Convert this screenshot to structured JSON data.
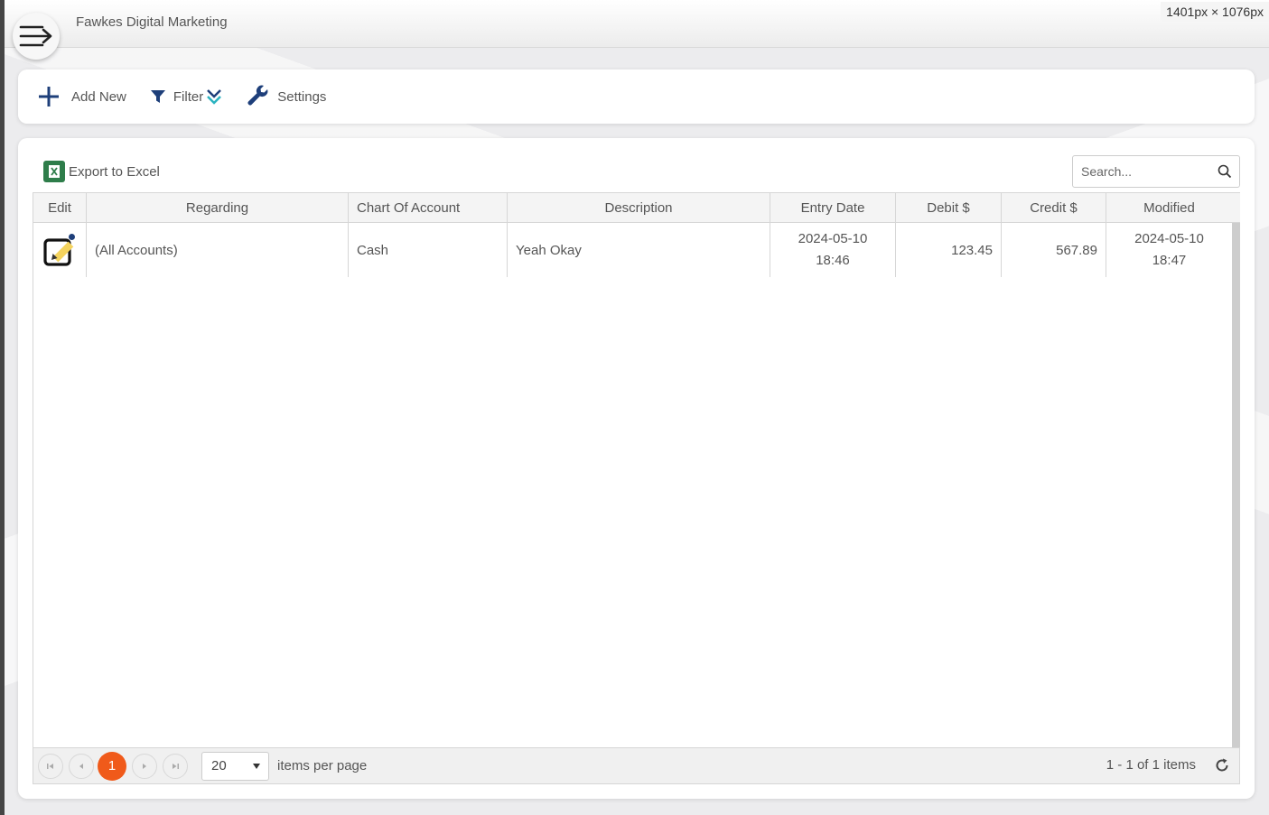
{
  "app": {
    "title": "Fawkes Digital Marketing",
    "dims_badge": "1401px × 1076px"
  },
  "toolbar": {
    "add_new": "Add New",
    "filter": "Filter",
    "settings": "Settings"
  },
  "grid": {
    "export_label": "Export to Excel",
    "search_placeholder": "Search...",
    "columns": [
      "Edit",
      "Regarding",
      "Chart Of Account",
      "Description",
      "Entry Date",
      "Debit $",
      "Credit $",
      "Modified"
    ],
    "rows": [
      {
        "regarding": "(All Accounts)",
        "chart_of_account": "Cash",
        "description": "Yeah Okay",
        "entry_date": "2024-05-10",
        "entry_time": "18:46",
        "debit": "123.45",
        "credit": "567.89",
        "modified_date": "2024-05-10",
        "modified_time": "18:47"
      }
    ]
  },
  "pager": {
    "current_page": "1",
    "page_size": "20",
    "items_per_page_label": "items per page",
    "info": "1 - 1 of 1 items"
  },
  "colors": {
    "accent": "#f05a1a",
    "toolbar_icon": "#1e3f7a",
    "excel_green": "#2e7d4a",
    "edit_yellow": "#f4d35e"
  },
  "icons": [
    "hamburger-arrow-icon",
    "plus-icon",
    "filter-funnel-icon",
    "chevron-double-down-icon",
    "wrench-icon",
    "excel-icon",
    "search-icon",
    "edit-pencil-icon",
    "first-page-icon",
    "prev-page-icon",
    "next-page-icon",
    "last-page-icon",
    "caret-down-icon",
    "refresh-icon"
  ]
}
